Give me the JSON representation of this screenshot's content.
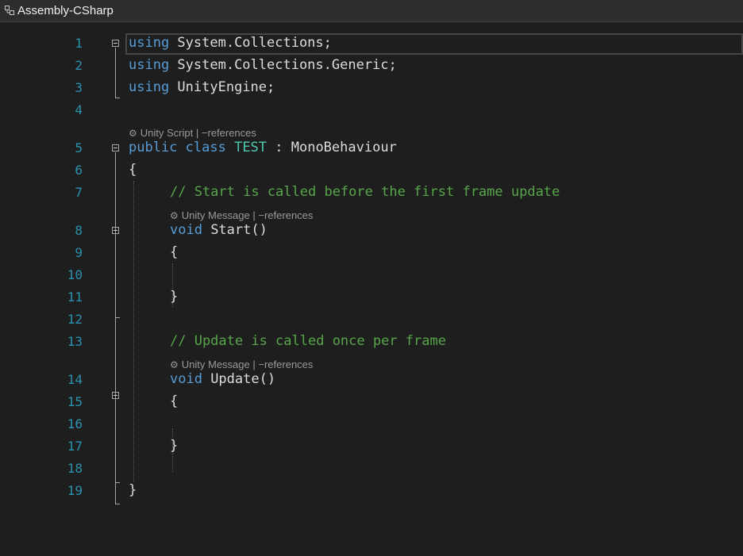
{
  "header": {
    "project_name": "Assembly-CSharp"
  },
  "colors": {
    "background": "#1e1e1e",
    "line_number": "#2b91af",
    "keyword": "#569cd6",
    "type": "#4ec9b0",
    "comment": "#57a64a",
    "plain": "#dcdcdc",
    "codelens": "#999999"
  },
  "gutter": {
    "line_numbers": [
      "1",
      "2",
      "3",
      "4",
      "5",
      "6",
      "7",
      "8",
      "9",
      "10",
      "11",
      "12",
      "13",
      "14",
      "15",
      "16",
      "17",
      "18",
      "19"
    ]
  },
  "code": {
    "l1": {
      "kw": "using",
      "rest": " System.Collections;"
    },
    "l2": {
      "kw": "using",
      "rest": " System.Collections.Generic;"
    },
    "l3": {
      "kw": "using",
      "rest": " UnityEngine;"
    },
    "l5": {
      "kw": "public class",
      "type": "TEST",
      "rest": " : MonoBehaviour"
    },
    "l6": {
      "text": "{"
    },
    "l7": {
      "comment": "// Start is called before the first frame update"
    },
    "l8": {
      "kw": "void",
      "rest": " Start()"
    },
    "l9": {
      "text": "{"
    },
    "l11": {
      "text": "}"
    },
    "l13": {
      "comment": "// Update is called once per frame"
    },
    "l14": {
      "kw": "void",
      "rest": " Update()"
    },
    "l15": {
      "text": "{"
    },
    "l17": {
      "text": "}"
    },
    "l18": {
      "text": "}"
    }
  },
  "codelens": {
    "class_lens": {
      "icon": "unity-icon",
      "label": "Unity Script",
      "sep": "|",
      "refs": "−references"
    },
    "start_lens": {
      "icon": "unity-icon",
      "label": "Unity Message",
      "sep": "|",
      "refs": "−references"
    },
    "update_lens": {
      "icon": "unity-icon",
      "label": "Unity Message",
      "sep": "|",
      "refs": "−references"
    }
  }
}
